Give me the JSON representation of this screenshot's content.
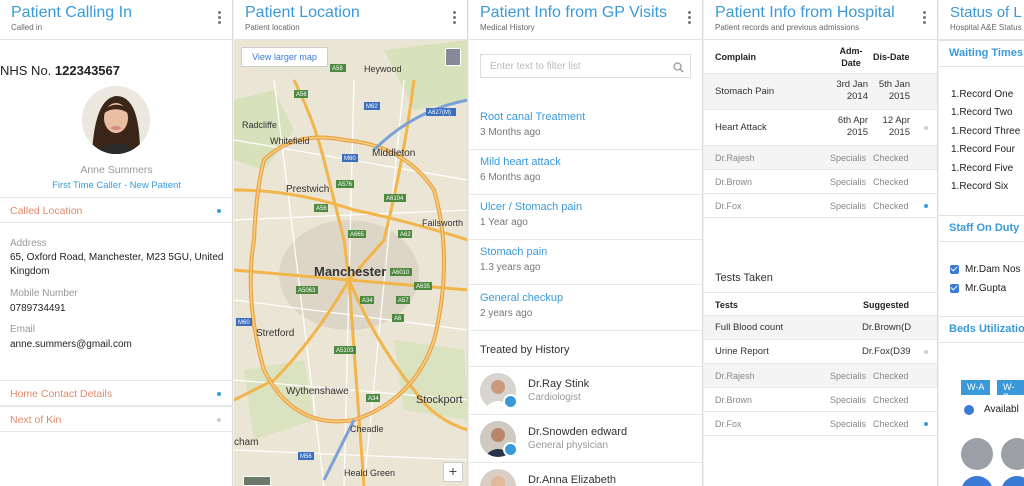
{
  "panel1": {
    "title": "Patient Calling In",
    "subtitle": "Called in",
    "nhs_label": "NHS No.",
    "nhs_number": "122343567",
    "name": "Anne Summers",
    "status": "First Time Caller - New Patient",
    "called_location": "Called Location",
    "address_label": "Address",
    "address": "65, Oxford Road, Manchester, M23 5GU, United Kingdom",
    "mobile_label": "Mobile Number",
    "mobile": "0789734491",
    "email_label": "Email",
    "email": "anne.summers@gmail.com",
    "home_contact": "Home Contact Details",
    "next_of_kin": "Next of Kin"
  },
  "panel2": {
    "title": "Patient Location",
    "subtitle": "Patient location",
    "view_larger": "View larger map",
    "zoom": "+",
    "places": {
      "heywood": "Heywood",
      "radcliffe": "Radcliffe",
      "whitefield": "Whitefield",
      "middleton": "Middleton",
      "prestwich": "Prestwich",
      "failsworth": "Failsworth",
      "manchester": "Manchester",
      "stretford": "Stretford",
      "wythenshawe": "Wythenshawe",
      "stockport": "Stockport",
      "cheadle": "Cheadle",
      "cham": "cham",
      "heald_green": "Heald Green"
    },
    "roads": [
      "A58",
      "A56",
      "A627(M)",
      "M62",
      "M60",
      "A576",
      "A56",
      "A6104",
      "A62",
      "A665",
      "A6010",
      "A635",
      "A5063",
      "A34",
      "A57",
      "A6",
      "A5103",
      "A34",
      "M56",
      "M60"
    ]
  },
  "panel3": {
    "title": "Patient Info from GP Visits",
    "subtitle": "Medical History",
    "filter_placeholder": "Enter text to filter list",
    "visits": [
      {
        "title": "Root canal Treatment",
        "when": "3 Months ago"
      },
      {
        "title": "Mild heart attack",
        "when": "6 Months ago"
      },
      {
        "title": "Ulcer / Stomach pain",
        "when": "1 Year ago"
      },
      {
        "title": "Stomach pain",
        "when": "1.3 years ago"
      },
      {
        "title": "General checkup",
        "when": "2 years ago"
      }
    ],
    "treated_by": "Treated by History",
    "doctors": [
      {
        "name": "Dr.Ray Stink",
        "role": "Cardiologist"
      },
      {
        "name": "Dr.Snowden edward",
        "role": "General physician"
      },
      {
        "name": "Dr.Anna Elizabeth",
        "role": ""
      }
    ]
  },
  "panel4": {
    "title": "Patient Info from Hospital",
    "subtitle": "Patient records and previous admissions",
    "col_complain": "Complain",
    "col_adm": "Adm-Date",
    "col_dis": "Dis-Date",
    "admissions": [
      {
        "complain": "Stomach Pain",
        "adm": "3rd Jan 2014",
        "dis": "5th Jan 2015"
      },
      {
        "complain": "Heart Attack",
        "adm": "6th Apr 2015",
        "dis": "12 Apr 2015"
      }
    ],
    "staff_rows": [
      {
        "doc": "Dr.Rajesh",
        "spec": "Specialis",
        "chk": "Checked"
      },
      {
        "doc": "Dr.Brown",
        "spec": "Specialis",
        "chk": "Checked"
      },
      {
        "doc": "Dr.Fox",
        "spec": "Specialis",
        "chk": "Checked"
      }
    ],
    "tests_taken": "Tests Taken",
    "col_tests": "Tests",
    "col_suggested": "Suggested",
    "tests": [
      {
        "test": "Full Blood count",
        "by": "Dr.Brown(D"
      },
      {
        "test": "Urine Report",
        "by": "Dr.Fox(D39"
      }
    ],
    "staff_rows2": [
      {
        "doc": "Dr.Rajesh",
        "spec": "Specialis",
        "chk": "Checked"
      },
      {
        "doc": "Dr.Brown",
        "spec": "Specialis",
        "chk": "Checked"
      },
      {
        "doc": "Dr.Fox",
        "spec": "Specialis",
        "chk": "Checked"
      }
    ]
  },
  "panel5": {
    "title": "Status of L",
    "subtitle": "Hospital A&E Status",
    "waiting": "Waiting Times",
    "records": [
      "1.Record One",
      "1.Record Two",
      "1.Record Three",
      "1.Record Four",
      "1.Record Five",
      "1.Record Six"
    ],
    "staff_title": "Staff On Duty",
    "staff": [
      "Mr.Dam Nos",
      "Mr.Gupta"
    ],
    "beds_title": "Beds Utilization",
    "ward_a": "W-A",
    "ward_b": "W-B",
    "available": "Availabl"
  },
  "colors": {
    "accent": "#3a9ad9",
    "section": "#e08a6b"
  }
}
